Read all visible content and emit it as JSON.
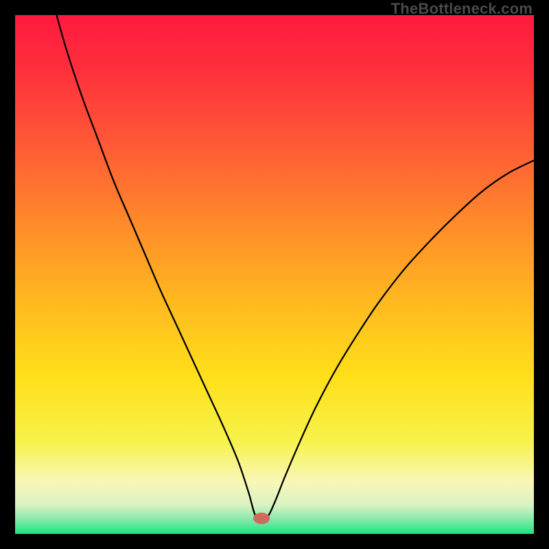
{
  "watermark": "TheBottleneck.com",
  "chart_data": {
    "type": "line",
    "title": "",
    "xlabel": "",
    "ylabel": "",
    "xlim": [
      0,
      100
    ],
    "ylim": [
      0,
      100
    ],
    "grid": false,
    "legend": false,
    "gradient_stops": [
      {
        "offset": 0.0,
        "color": "#ff1a3f"
      },
      {
        "offset": 0.1,
        "color": "#ff2e3c"
      },
      {
        "offset": 0.25,
        "color": "#ff5a36"
      },
      {
        "offset": 0.4,
        "color": "#ff8a2a"
      },
      {
        "offset": 0.55,
        "color": "#ffb81f"
      },
      {
        "offset": 0.7,
        "color": "#ffe01a"
      },
      {
        "offset": 0.82,
        "color": "#f6f24a"
      },
      {
        "offset": 0.9,
        "color": "#f8f7b8"
      },
      {
        "offset": 0.945,
        "color": "#d9f2c2"
      },
      {
        "offset": 0.975,
        "color": "#7de8a8"
      },
      {
        "offset": 1.0,
        "color": "#17e67e"
      }
    ],
    "marker": {
      "x": 47.5,
      "y": 3.0,
      "color": "#cf6b5e",
      "rx": 1.6,
      "ry": 1.1
    },
    "series": [
      {
        "name": "curve",
        "stroke": "#000000",
        "stroke_width": 2.3,
        "x": [
          8.0,
          10.0,
          13.0,
          16.0,
          19.0,
          22.0,
          25.0,
          28.0,
          31.0,
          34.0,
          37.0,
          40.0,
          43.0,
          45.0,
          46.5,
          48.5,
          50.0,
          52.0,
          55.0,
          58.0,
          62.0,
          66.0,
          70.0,
          75.0,
          80.0,
          85.0,
          90.0,
          95.0,
          100.0
        ],
        "y": [
          100.0,
          93.0,
          84.0,
          76.0,
          68.0,
          61.0,
          54.0,
          47.0,
          40.5,
          34.0,
          27.5,
          21.0,
          14.0,
          8.0,
          3.2,
          3.2,
          6.0,
          11.0,
          18.0,
          24.5,
          32.0,
          38.5,
          44.5,
          51.0,
          56.5,
          61.5,
          66.0,
          69.5,
          72.0
        ]
      }
    ]
  }
}
